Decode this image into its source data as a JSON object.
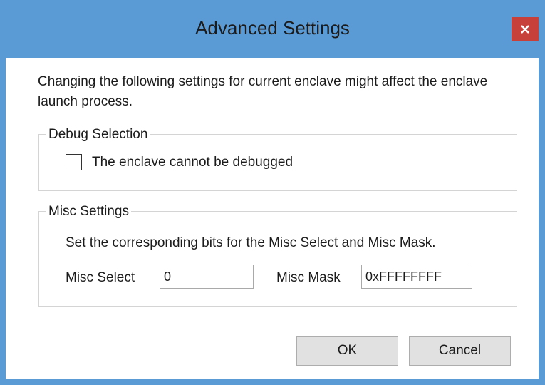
{
  "window": {
    "title": "Advanced Settings",
    "close_icon": "close-icon"
  },
  "intro": {
    "text": "Changing the following settings for current enclave might affect the enclave launch process."
  },
  "debug_group": {
    "legend": "Debug Selection",
    "checkbox_label": "The enclave cannot be debugged",
    "checked": false
  },
  "misc_group": {
    "legend": "Misc Settings",
    "description": "Set the corresponding bits for the Misc Select and Misc Mask.",
    "misc_select_label": "Misc Select",
    "misc_select_value": "0",
    "misc_mask_label": "Misc Mask",
    "misc_mask_value": "0xFFFFFFFF"
  },
  "buttons": {
    "ok": "OK",
    "cancel": "Cancel"
  },
  "colors": {
    "titlebar": "#5b9bd5",
    "close_button": "#c7403a"
  }
}
